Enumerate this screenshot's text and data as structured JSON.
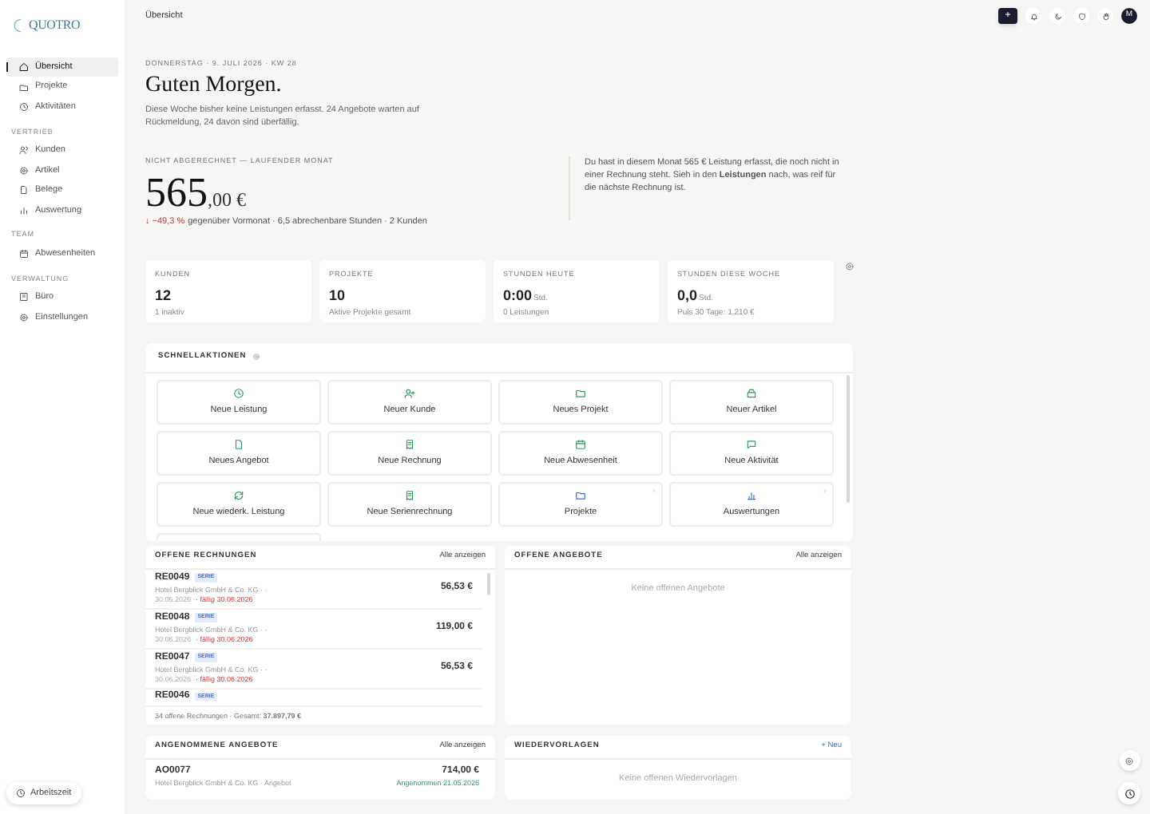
{
  "logo": "QUOTRO",
  "sidebar": {
    "items": [
      {
        "label": "Übersicht",
        "selected": true
      },
      {
        "label": "Projekte",
        "selected": false
      },
      {
        "label": "Aktivitäten",
        "selected": false
      }
    ],
    "sections": [
      {
        "title": "VERTRIEB",
        "items": [
          {
            "label": "Kunden",
            "selected": false
          },
          {
            "label": "Artikel",
            "selected": false
          },
          {
            "label": "Belege",
            "selected": false
          },
          {
            "label": "Auswertung",
            "selected": false
          }
        ]
      },
      {
        "title": "TEAM",
        "items": [
          {
            "label": "Abwesenheiten",
            "selected": false
          }
        ]
      },
      {
        "title": "VERWALTUNG",
        "items": [
          {
            "label": "Büro",
            "selected": false
          },
          {
            "label": "Einstellungen",
            "selected": false
          }
        ]
      }
    ],
    "work_time_button": "Arbeitszeit"
  },
  "header": {
    "breadcrumb": "Übersicht",
    "add_button": "+",
    "avatar": "M"
  },
  "greeting": {
    "date": "DONNERSTAG · 9. JULI 2026 · KW 28",
    "title": "Guten Morgen.",
    "text": "Diese Woche bisher keine Leistungen erfasst. 24 Angebote warten auf Rückmeldung, 24 davon sind überfällig."
  },
  "unbilled": {
    "label": "NICHT ABGERECHNET — LAUFENDER MONAT",
    "amount": "565",
    "decimals": ",00 €",
    "change": "↓ −49,3 %",
    "details": "gegenüber Vormonat · 6,5 abrechenbare Stunden · 2 Kunden",
    "note": "Du hast in diesem Monat 565 € Leistung erfasst, die noch nicht in einer Rechnung steht. Sieh in den **Leistungen** nach, was reif für die nächste Rechnung ist."
  },
  "stats": [
    {
      "label": "KUNDEN",
      "value": "12",
      "sub": "1 inaktiv"
    },
    {
      "label": "PROJEKTE",
      "value": "10",
      "sub": "Aktive Projekte gesamt"
    },
    {
      "label": "STUNDEN HEUTE",
      "value": "0:00",
      "unit": "Std.",
      "sub": "0 Leistungen"
    },
    {
      "label": "STUNDEN DIESE WOCHE",
      "value": "0,0",
      "unit": "Std.",
      "sub": "Puls 30 Tage: 1.210 €"
    }
  ],
  "quick_actions": {
    "title": "SCHNELLAKTIONEN",
    "tiles": [
      {
        "label": "Neue Leistung",
        "kind": "create"
      },
      {
        "label": "Neuer Kunde",
        "kind": "create"
      },
      {
        "label": "Neues Projekt",
        "kind": "create"
      },
      {
        "label": "Neuer Artikel",
        "kind": "create"
      },
      {
        "label": "Neues Angebot",
        "kind": "create"
      },
      {
        "label": "Neue Rechnung",
        "kind": "create"
      },
      {
        "label": "Neue Abwesenheit",
        "kind": "create"
      },
      {
        "label": "Neue Aktivität",
        "kind": "create"
      },
      {
        "label": "Neue wiederk. Leistung",
        "kind": "create"
      },
      {
        "label": "Neue Serienrechnung",
        "kind": "create"
      },
      {
        "label": "Projekte",
        "kind": "link"
      },
      {
        "label": "Auswertungen",
        "kind": "link"
      }
    ]
  },
  "open_invoices": {
    "title": "OFFENE RECHNUNGEN",
    "link": "Alle anzeigen",
    "rows": [
      {
        "number": "RE0049",
        "badge": "SERIE",
        "client": "Hotel Bergblick GmbH & Co. KG · ·",
        "date": "30.06.2026",
        "due": "· fällig 30.06.2026",
        "amount": "56,53 €"
      },
      {
        "number": "RE0048",
        "badge": "SERIE",
        "client": "Hotel Bergblick GmbH & Co. KG · ·",
        "date": "30.06.2026",
        "due": "· fällig 30.06.2026",
        "amount": "119,00 €"
      },
      {
        "number": "RE0047",
        "badge": "SERIE",
        "client": "Hotel Bergblick GmbH & Co. KG · ·",
        "date": "30.06.2026",
        "due": "· fällig 30.06.2026",
        "amount": "56,53 €"
      },
      {
        "number": "RE0046",
        "badge": "SERIE"
      }
    ],
    "footer": "34 offene Rechnungen · Gesamt: **37.897,79 €**"
  },
  "open_offers": {
    "title": "OFFENE ANGEBOTE",
    "link": "Alle anzeigen",
    "empty": "Keine offenen Angebote"
  },
  "accepted_offers": {
    "title": "ANGENOMMENE ANGEBOTE",
    "link": "Alle anzeigen",
    "rows": [
      {
        "number": "AO0077",
        "client": "Hotel Bergblick GmbH & Co. KG · Angebot",
        "amount": "714,00 €",
        "status": "Angenommen 21.05.2026"
      }
    ]
  },
  "follow_ups": {
    "title": "WIEDERVORLAGEN",
    "link": "+ Neu",
    "empty": "Keine offenen Wiedervorlagen"
  }
}
